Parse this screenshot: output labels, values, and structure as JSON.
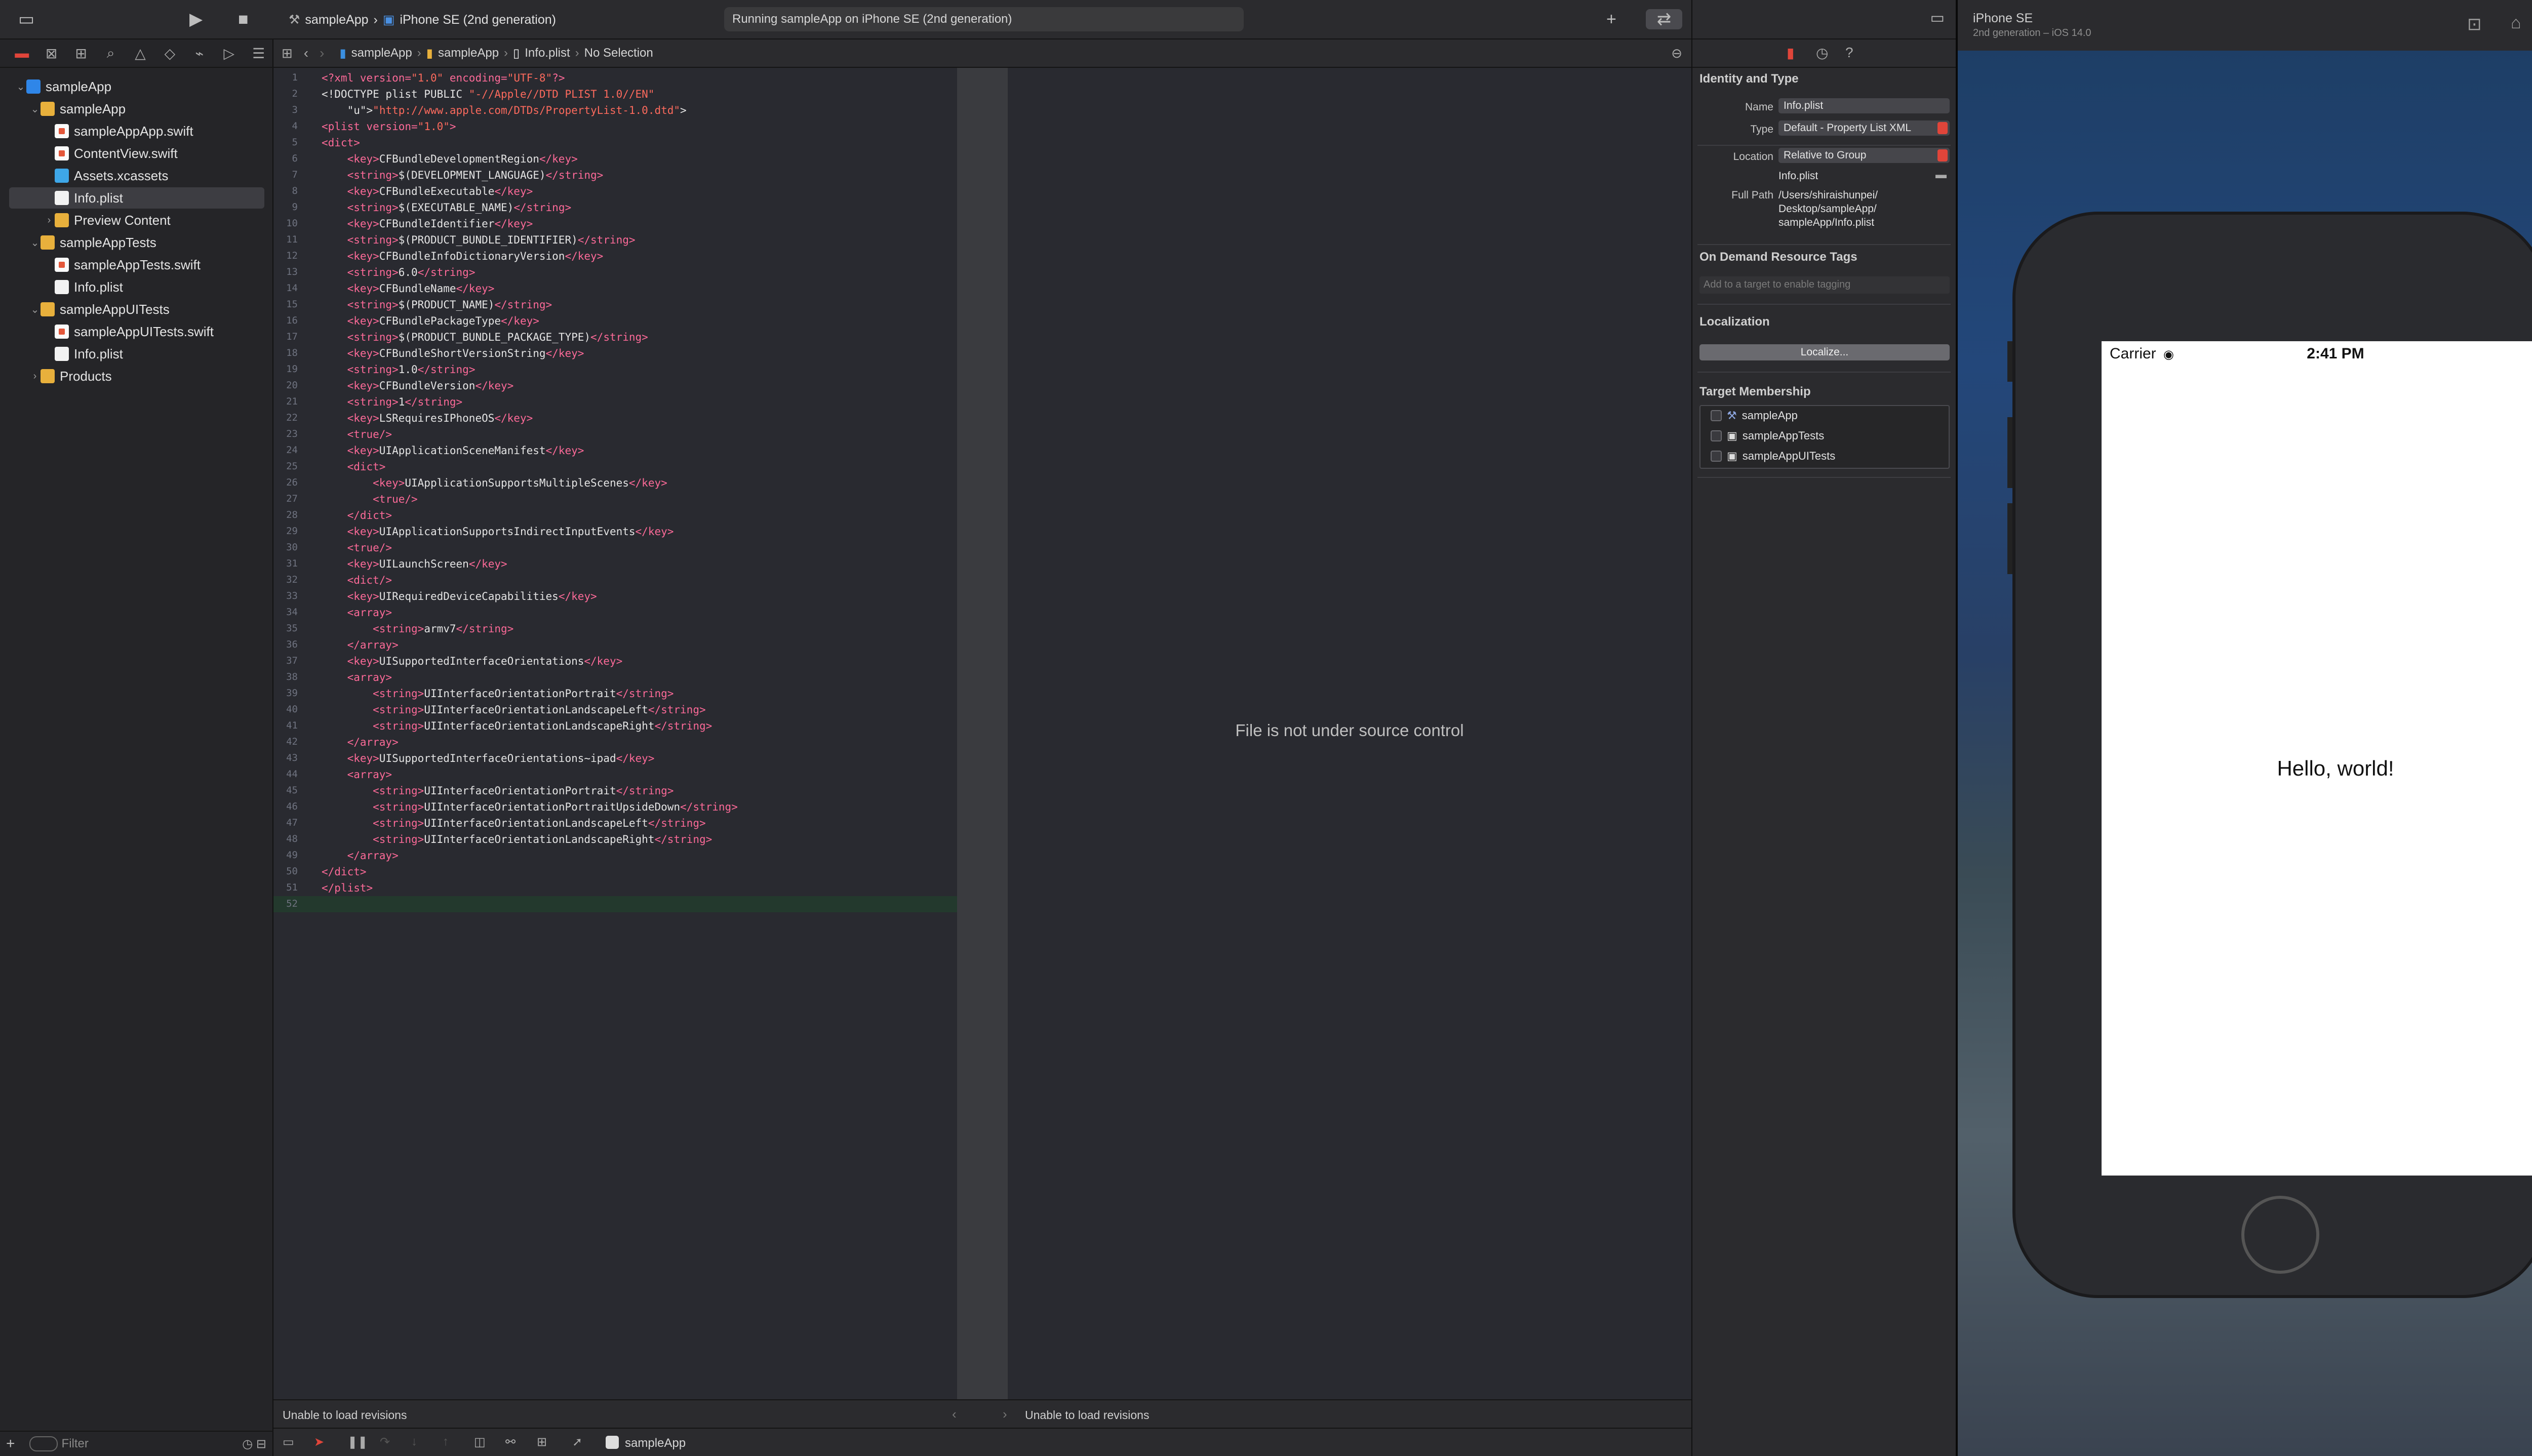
{
  "toolbar": {
    "scheme": "sampleApp",
    "destination": "iPhone SE (2nd generation)",
    "activity": "Running sampleApp on iPhone SE (2nd generation)"
  },
  "navigator": {
    "tree": [
      {
        "label": "sampleApp",
        "kind": "proj",
        "indent": 0,
        "disclosure": "open"
      },
      {
        "label": "sampleApp",
        "kind": "folder",
        "indent": 1,
        "disclosure": "open"
      },
      {
        "label": "sampleAppApp.swift",
        "kind": "swift",
        "indent": 2,
        "disclosure": ""
      },
      {
        "label": "ContentView.swift",
        "kind": "swift",
        "indent": 2,
        "disclosure": ""
      },
      {
        "label": "Assets.xcassets",
        "kind": "assets",
        "indent": 2,
        "disclosure": ""
      },
      {
        "label": "Info.plist",
        "kind": "plist",
        "indent": 2,
        "disclosure": "",
        "selected": true
      },
      {
        "label": "Preview Content",
        "kind": "folder",
        "indent": 2,
        "disclosure": "closed"
      },
      {
        "label": "sampleAppTests",
        "kind": "folder",
        "indent": 1,
        "disclosure": "open"
      },
      {
        "label": "sampleAppTests.swift",
        "kind": "swift",
        "indent": 2,
        "disclosure": ""
      },
      {
        "label": "Info.plist",
        "kind": "plist",
        "indent": 2,
        "disclosure": ""
      },
      {
        "label": "sampleAppUITests",
        "kind": "folder",
        "indent": 1,
        "disclosure": "open"
      },
      {
        "label": "sampleAppUITests.swift",
        "kind": "swift",
        "indent": 2,
        "disclosure": ""
      },
      {
        "label": "Info.plist",
        "kind": "plist",
        "indent": 2,
        "disclosure": ""
      },
      {
        "label": "Products",
        "kind": "folder",
        "indent": 1,
        "disclosure": "closed"
      }
    ],
    "filter_placeholder": "Filter"
  },
  "jumpbar": {
    "crumbs": [
      "sampleApp",
      "sampleApp",
      "Info.plist",
      "No Selection"
    ]
  },
  "code": [
    "<?xml version=\"1.0\" encoding=\"UTF-8\"?>",
    "<!DOCTYPE plist PUBLIC \"-//Apple//DTD PLIST 1.0//EN\"",
    "    \"http://www.apple.com/DTDs/PropertyList-1.0.dtd\">",
    "<plist version=\"1.0\">",
    "<dict>",
    "    <key>CFBundleDevelopmentRegion</key>",
    "    <string>$(DEVELOPMENT_LANGUAGE)</string>",
    "    <key>CFBundleExecutable</key>",
    "    <string>$(EXECUTABLE_NAME)</string>",
    "    <key>CFBundleIdentifier</key>",
    "    <string>$(PRODUCT_BUNDLE_IDENTIFIER)</string>",
    "    <key>CFBundleInfoDictionaryVersion</key>",
    "    <string>6.0</string>",
    "    <key>CFBundleName</key>",
    "    <string>$(PRODUCT_NAME)</string>",
    "    <key>CFBundlePackageType</key>",
    "    <string>$(PRODUCT_BUNDLE_PACKAGE_TYPE)</string>",
    "    <key>CFBundleShortVersionString</key>",
    "    <string>1.0</string>",
    "    <key>CFBundleVersion</key>",
    "    <string>1</string>",
    "    <key>LSRequiresIPhoneOS</key>",
    "    <true/>",
    "    <key>UIApplicationSceneManifest</key>",
    "    <dict>",
    "        <key>UIApplicationSupportsMultipleScenes</key>",
    "        <true/>",
    "    </dict>",
    "    <key>UIApplicationSupportsIndirectInputEvents</key>",
    "    <true/>",
    "    <key>UILaunchScreen</key>",
    "    <dict/>",
    "    <key>UIRequiredDeviceCapabilities</key>",
    "    <array>",
    "        <string>armv7</string>",
    "    </array>",
    "    <key>UISupportedInterfaceOrientations</key>",
    "    <array>",
    "        <string>UIInterfaceOrientationPortrait</string>",
    "        <string>UIInterfaceOrientationLandscapeLeft</string>",
    "        <string>UIInterfaceOrientationLandscapeRight</string>",
    "    </array>",
    "    <key>UISupportedInterfaceOrientations~ipad</key>",
    "    <array>",
    "        <string>UIInterfaceOrientationPortrait</string>",
    "        <string>UIInterfaceOrientationPortraitUpsideDown</string>",
    "        <string>UIInterfaceOrientationLandscapeLeft</string>",
    "        <string>UIInterfaceOrientationLandscapeRight</string>",
    "    </array>",
    "</dict>",
    "</plist>",
    ""
  ],
  "compare": {
    "message": "File is not under source control"
  },
  "revisions": {
    "left": "Unable to load revisions",
    "right": "Unable to load revisions"
  },
  "debugbar": {
    "target": "sampleApp"
  },
  "inspector": {
    "identity_header": "Identity and Type",
    "name_label": "Name",
    "name_value": "Info.plist",
    "type_label": "Type",
    "type_value": "Default - Property List XML",
    "location_label": "Location",
    "location_value": "Relative to Group",
    "location_file": "Info.plist",
    "fullpath_label": "Full Path",
    "fullpath_value": "/Users/shiraishunpei/ Desktop/sampleApp/ sampleApp/Info.plist",
    "odr_header": "On Demand Resource Tags",
    "odr_placeholder": "Add to a target to enable tagging",
    "loc_header": "Localization",
    "localize_button": "Localize...",
    "tm_header": "Target Membership",
    "targets": [
      "sampleApp",
      "sampleAppTests",
      "sampleAppUITests"
    ]
  },
  "simulator": {
    "device": "iPhone SE",
    "subtitle": "2nd generation – iOS 14.0",
    "carrier": "Carrier",
    "time": "2:41 PM",
    "content": "Hello, world!"
  },
  "colors": {
    "accent": "#e0453a",
    "keyword": "#fc6a98",
    "string": "#fc6a5d",
    "url": "#6c9ae8"
  }
}
